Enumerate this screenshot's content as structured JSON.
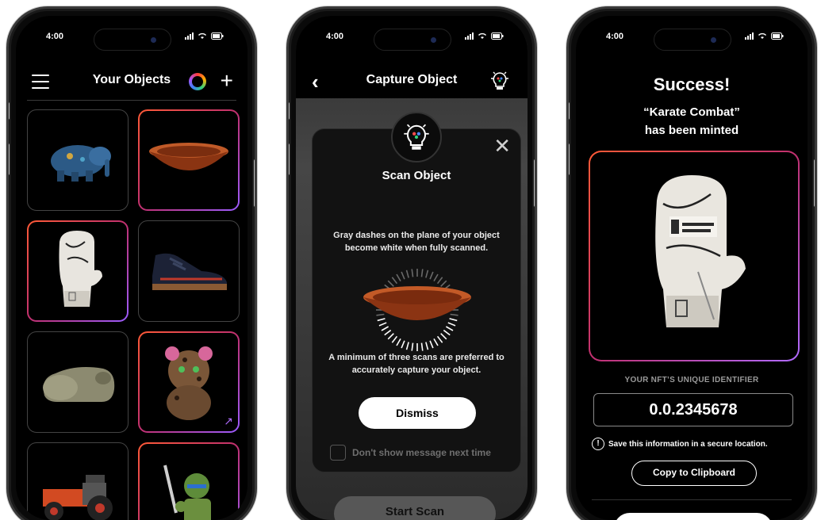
{
  "status": {
    "time": "4:00"
  },
  "phone1": {
    "title": "Your Objects",
    "objects": [
      {
        "name": "Blue elephant figurine",
        "icon": "elephant-icon"
      },
      {
        "name": "Wooden bowl",
        "icon": "bowl-icon"
      },
      {
        "name": "Signed boxing glove",
        "icon": "glove-icon"
      },
      {
        "name": "Sneaker",
        "icon": "sneaker-icon"
      },
      {
        "name": "Hippo figurine",
        "icon": "hippo-icon"
      },
      {
        "name": "Leopard plush toy",
        "icon": "plush-icon"
      },
      {
        "name": "Toy tractor",
        "icon": "tractor-icon"
      },
      {
        "name": "Turtle action figure",
        "icon": "figure-icon"
      }
    ]
  },
  "phone2": {
    "title": "Capture Object",
    "modal": {
      "title": "Scan Object",
      "text1": "Gray dashes on the plane of your object become white when fully scanned.",
      "text2": "A minimum of three scans are preferred to accurately capture your object.",
      "dismiss": "Dismiss",
      "checkbox_label": "Don't show message next time"
    },
    "start_scan": "Start Scan"
  },
  "phone3": {
    "success": "Success!",
    "minted_line1": "“Karate Combat”",
    "minted_line2": "has been minted",
    "uid_label": "YOUR NFT’S UNIQUE IDENTIFIER",
    "uid_value": "0.0.2345678",
    "info_icon_glyph": "!",
    "info_text": "Save this information in a secure location.",
    "copy_button": "Copy to Clipboard"
  }
}
